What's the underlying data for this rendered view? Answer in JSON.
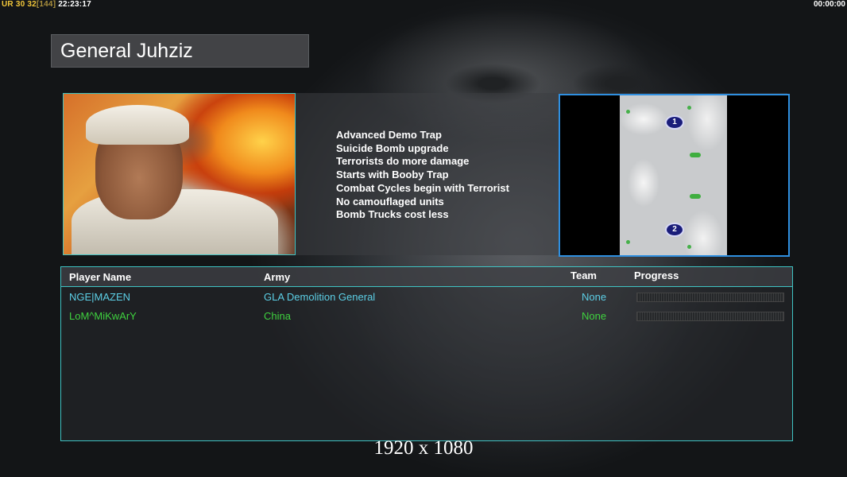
{
  "hud": {
    "left_a": "UR",
    "left_b": "30",
    "left_c": "32",
    "left_d": "[144]",
    "left_e": "22:23:17",
    "right_time": "00:00:00"
  },
  "general_name": "General Juhziz",
  "traits": [
    "Advanced Demo Trap",
    "Suicide Bomb upgrade",
    "Terrorists do more damage",
    "Starts with Booby Trap",
    "Combat Cycles begin with Terrorist",
    "No camouflaged units",
    "Bomb Trucks cost less"
  ],
  "minimap": {
    "spawn_1": "1",
    "spawn_2": "2"
  },
  "table": {
    "headers": {
      "player_name": "Player Name",
      "army": "Army",
      "team": "Team",
      "progress": "Progress"
    },
    "rows": [
      {
        "name": "NGE|MAZEN",
        "army": "GLA Demolition General",
        "team": "None",
        "color": "#5ccfe6",
        "progress": 0
      },
      {
        "name": "LoM^MiKwArY",
        "army": "China",
        "team": "None",
        "color": "#3fd23f",
        "progress": 0
      }
    ]
  },
  "resolution_label": "1920 x 1080",
  "colors": {
    "panel_border": "#3fc3c3",
    "minimap_border": "#2f8fe0"
  }
}
